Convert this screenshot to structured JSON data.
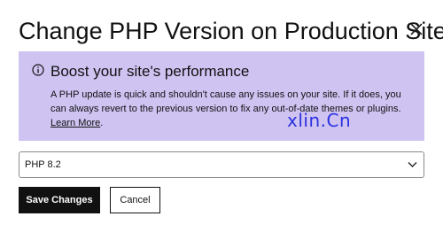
{
  "dialog": {
    "title": "Change PHP Version on Production Site"
  },
  "banner": {
    "background": "#cfc3f2",
    "icon": "info-icon",
    "title": "Boost your site's performance",
    "body_text": "A PHP update is quick and shouldn't cause any issues on your site. If it does, you can always revert to the previous version to fix any out-of-date themes or plugins. ",
    "link_label": "Learn More",
    "link_suffix": "."
  },
  "watermark": {
    "text": "xlin.Cn",
    "color": "#2a32e0"
  },
  "version_select": {
    "selected": "PHP 8.2",
    "icon": "chevron-down-icon"
  },
  "actions": {
    "save_label": "Save Changes",
    "cancel_label": "Cancel"
  }
}
